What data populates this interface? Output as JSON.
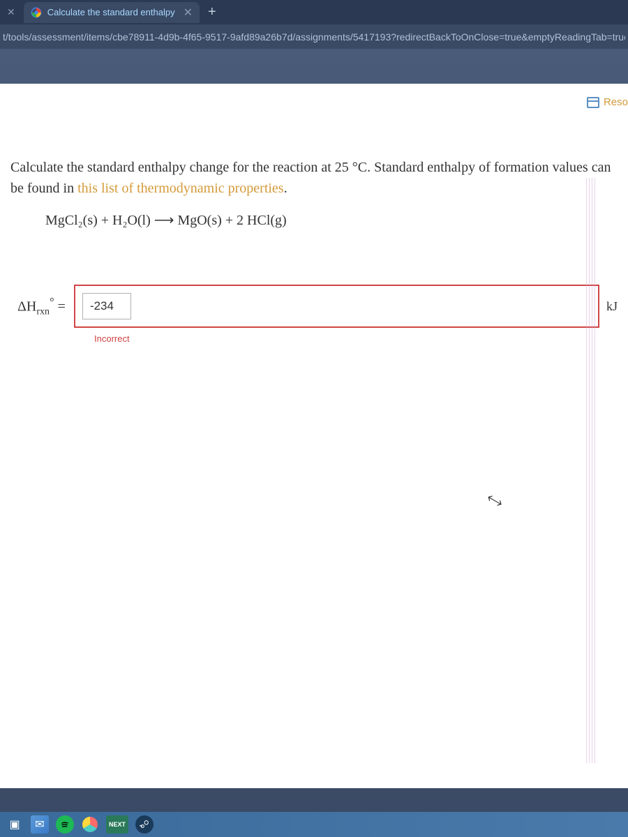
{
  "browser": {
    "tab_title": "Calculate the standard enthalpy",
    "url": "t/tools/assessment/items/cbe78911-4d9b-4f65-9517-9afd89a26b7d/assignments/5417193?redirectBackToOnClose=true&emptyReadingTab=true&nga"
  },
  "page": {
    "resources_label": "Reso",
    "question_part1": "Calculate the standard enthalpy change for the reaction at 25 °C. Standard enthalpy of formation values can be found in ",
    "question_link1": "this list of thermodynamic properties",
    "question_period": ".",
    "equation": "MgCl₂(s) + H₂O(l) ⟶ MgO(s) + 2 HCl(g)",
    "answer_label_prefix": "ΔH",
    "answer_label_sub": "rxn",
    "answer_label_super": "°",
    "answer_label_equals": " =",
    "answer_value": "-234",
    "unit": "kJ",
    "feedback": "Incorrect"
  },
  "taskbar": {
    "next_label": "NEXT"
  }
}
